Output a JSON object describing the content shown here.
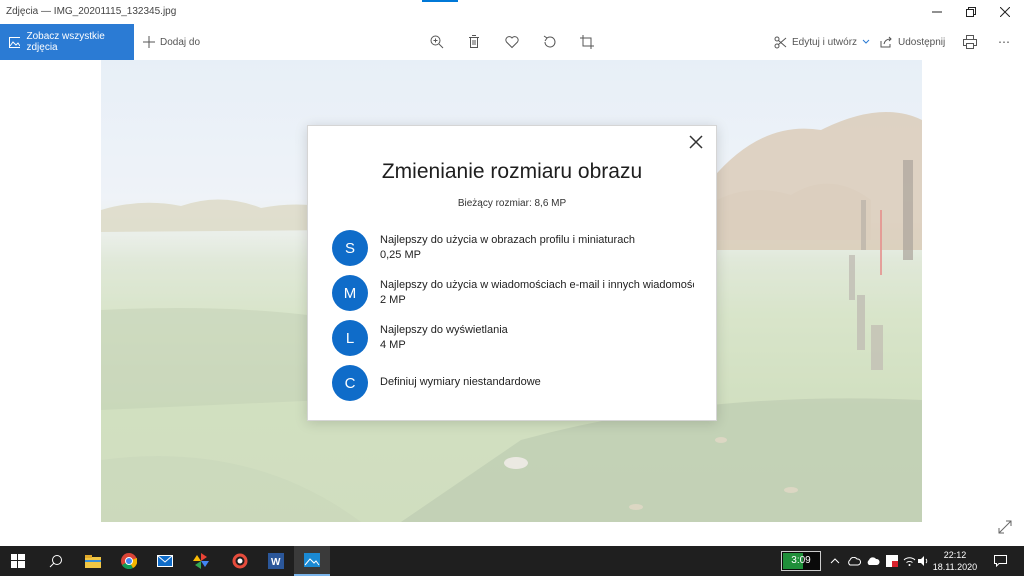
{
  "window": {
    "title": "Zdjęcia — IMG_20201115_132345.jpg"
  },
  "toolbar": {
    "see_all_label": "Zobacz wszystkie zdjęcia",
    "add_label": "Dodaj do",
    "edit_label": "Edytuj i utwórz",
    "share_label": "Udostępnij"
  },
  "dialog": {
    "title": "Zmienianie rozmiaru obrazu",
    "current_size": "Bieżący rozmiar: 8,6 MP",
    "options": [
      {
        "letter": "S",
        "label": "Najlepszy do użycia w obrazach profilu i miniaturach",
        "size": "0,25 MP"
      },
      {
        "letter": "M",
        "label": "Najlepszy do użycia w wiadomościach e-mail i innych wiadomościach",
        "size": "2 MP"
      },
      {
        "letter": "L",
        "label": "Najlepszy do wyświetlania",
        "size": "4 MP"
      },
      {
        "letter": "C",
        "label": "Definiuj wymiary niestandardowe",
        "size": ""
      }
    ]
  },
  "taskbar": {
    "battery_time": "3:09",
    "battery_level": 0.55,
    "time": "22:12",
    "date": "18.11.2020"
  },
  "colors": {
    "accent": "#0078d7",
    "option_circle": "#0f6cc9",
    "see_all_bg": "#2b7bd4"
  }
}
